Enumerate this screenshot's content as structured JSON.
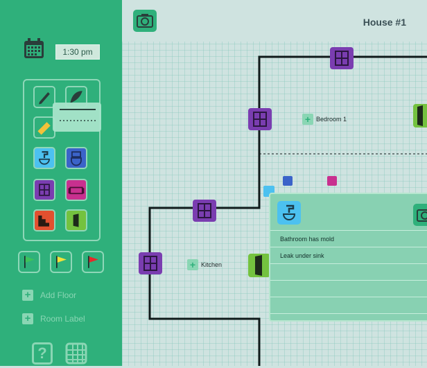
{
  "header": {
    "time": "1:30 pm",
    "house_title": "House #1"
  },
  "sidebar": {
    "tools": [
      {
        "name": "pencil-tool",
        "icon": "pencil-icon"
      },
      {
        "name": "curve-tool",
        "icon": "curve-icon"
      },
      {
        "name": "ruler-tool",
        "icon": "ruler-icon"
      },
      {
        "name": "eraser-tool",
        "icon": "eraser-icon"
      },
      {
        "name": "sink-tool",
        "icon": "sink-icon",
        "color": "#4cc1f0"
      },
      {
        "name": "toilet-tool",
        "icon": "toilet-icon",
        "color": "#3b63c9"
      },
      {
        "name": "window-tool",
        "icon": "window-icon",
        "color": "#7a3db0"
      },
      {
        "name": "sofa-tool",
        "icon": "sofa-icon",
        "color": "#c8308f"
      },
      {
        "name": "stairs-tool",
        "icon": "stairs-icon",
        "color": "#e2502f"
      },
      {
        "name": "door-tool",
        "icon": "door-icon",
        "color": "#74c23f"
      }
    ],
    "flags": [
      {
        "name": "green-flag",
        "color": "#3ec35a"
      },
      {
        "name": "yellow-flag",
        "color": "#f2e23a"
      },
      {
        "name": "red-flag",
        "color": "#e42a2a"
      }
    ],
    "add_floor_label": "Add Floor",
    "room_label_label": "Room Label"
  },
  "plan": {
    "rooms": [
      {
        "label": "Bedroom 1"
      },
      {
        "label": "Kitchen"
      }
    ]
  },
  "note": {
    "lines": [
      "Bathroom has mold",
      "Leak under sink"
    ]
  },
  "colors": {
    "sidebar": "#2fb07b",
    "grid_bg": "#cfe3e0",
    "grid_line": "#86c9bb",
    "window": "#7a3db0",
    "door": "#74c23f",
    "note_panel": "#88d1b2"
  }
}
